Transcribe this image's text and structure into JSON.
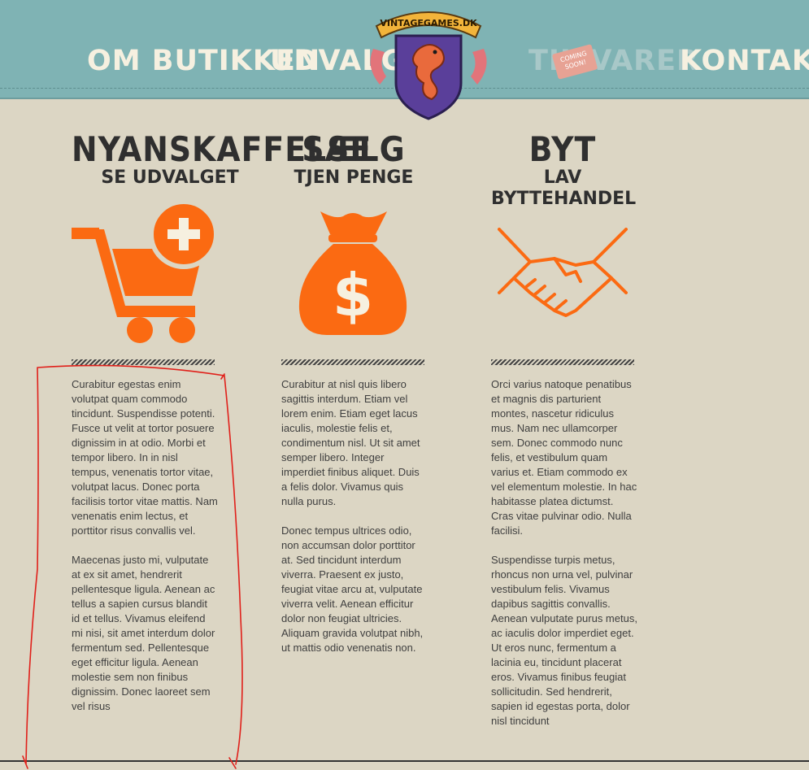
{
  "nav": {
    "items": [
      {
        "label": "OM BUTIKKEN"
      },
      {
        "label": "UDVALG"
      },
      {
        "label": "TIL VARER"
      },
      {
        "label": "KONTAKT"
      }
    ],
    "badge_line1": "COMING",
    "badge_line2": "SOON!"
  },
  "logo": {
    "text": "VINTAGEGAMES.DK"
  },
  "columns": [
    {
      "title": "NYANSKAFFELSE",
      "subtitle": "SE UDVALGET",
      "icon": "cart-plus-icon",
      "paragraphs": [
        "Curabitur egestas enim volutpat quam commodo tincidunt. Suspendisse potenti. Fusce ut velit at tortor posuere dignissim in at odio. Morbi et tempor libero. In in nisl tempus, venenatis tortor vitae, volutpat lacus. Donec porta facilisis tortor vitae mattis. Nam venenatis enim lectus, et porttitor risus convallis vel.",
        "Maecenas justo mi, vulputate at ex sit amet, hendrerit pellentesque ligula. Aenean ac tellus a sapien cursus blandit id et tellus. Vivamus eleifend mi nisi, sit amet interdum dolor fermentum sed. Pellentesque eget efficitur ligula. Aenean molestie sem non finibus dignissim. Donec laoreet sem vel risus"
      ]
    },
    {
      "title": "SÆLG",
      "subtitle": "TJEN PENGE",
      "icon": "money-bag-icon",
      "paragraphs": [
        "Curabitur at nisl quis libero sagittis interdum. Etiam vel lorem enim. Etiam eget lacus iaculis, molestie felis et, condimentum nisl. Ut sit amet semper libero. Integer imperdiet finibus aliquet. Duis a felis dolor. Vivamus quis nulla purus.",
        "Donec tempus ultrices odio, non accumsan dolor porttitor at. Sed tincidunt interdum viverra. Praesent ex justo, feugiat vitae arcu at, vulputate viverra velit. Aenean efficitur dolor non feugiat ultricies. Aliquam gravida volutpat nibh, ut mattis odio venenatis non."
      ]
    },
    {
      "title": "BYT",
      "subtitle": "LAV BYTTEHANDEL",
      "icon": "handshake-icon",
      "paragraphs": [
        "Orci varius natoque penatibus et magnis dis parturient montes, nascetur ridiculus mus. Nam nec ullamcorper sem. Donec commodo nunc felis, et vestibulum quam varius et. Etiam commodo ex vel elementum molestie. In hac habitasse platea dictumst. Cras vitae pulvinar odio. Nulla facilisi.",
        "Suspendisse turpis metus, rhoncus non urna vel, pulvinar vestibulum felis. Vivamus dapibus sagittis convallis. Aenean vulputate purus metus, ac iaculis dolor imperdiet eget. Ut eros nunc, fermentum a lacinia eu, tincidunt placerat eros. Vivamus finibus feugiat sollicitudin. Sed hendrerit, sapien id egestas porta, dolor nisl tincidunt"
      ]
    }
  ],
  "colors": {
    "header_bg": "#7fb3b4",
    "page_bg": "#dcd6c4",
    "accent": "#fb6a12",
    "annotation": "#e0201a"
  }
}
